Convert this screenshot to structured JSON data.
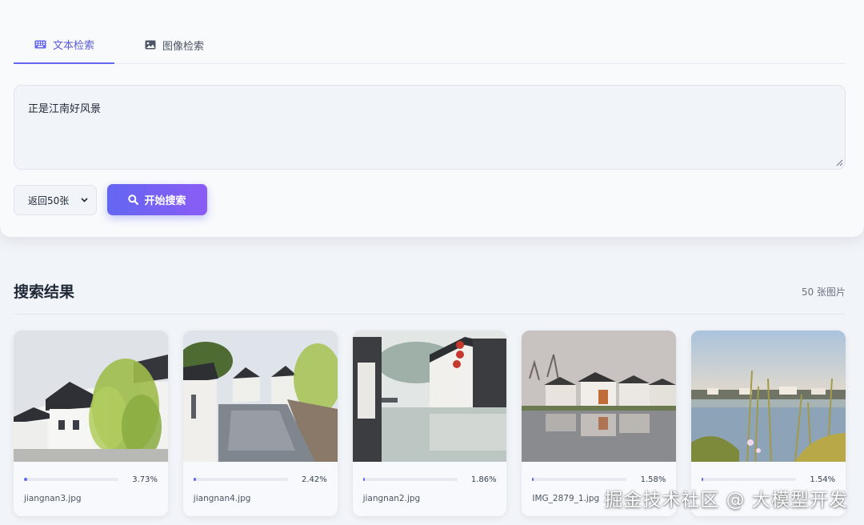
{
  "tabs": [
    {
      "label": "文本检索",
      "icon": "keyboard-icon",
      "active": true
    },
    {
      "label": "图像检索",
      "icon": "image-icon",
      "active": false
    }
  ],
  "query": {
    "value": "正是江南好风景"
  },
  "search": {
    "count_label": "返回50张",
    "button_label": "开始搜索"
  },
  "results": {
    "title": "搜索结果",
    "count": "50 张图片",
    "items": [
      {
        "filename": "jiangnan3.jpg",
        "score": "3.73%",
        "score_value": 3.73
      },
      {
        "filename": "jiangnan4.jpg",
        "score": "2.42%",
        "score_value": 2.42
      },
      {
        "filename": "jiangnan2.jpg",
        "score": "1.86%",
        "score_value": 1.86
      },
      {
        "filename": "IMG_2879_1.jpg",
        "score": "1.58%",
        "score_value": 1.58
      },
      {
        "filename": "",
        "score": "1.54%",
        "score_value": 1.54
      }
    ]
  },
  "watermark": "掘金技术社区 @ 大模型开发",
  "colors": {
    "accent": "#6366f1",
    "accent_end": "#8b5cf6",
    "background": "#f1f4f8"
  }
}
